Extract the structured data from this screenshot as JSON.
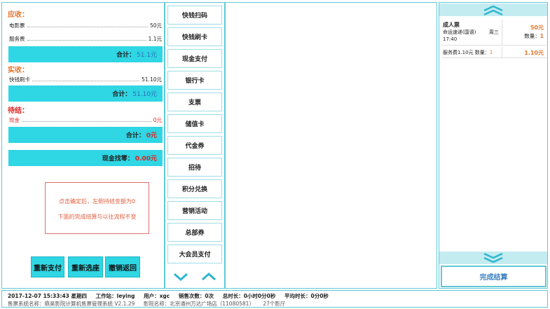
{
  "left": {
    "receivable": {
      "title": "应收：",
      "items": [
        {
          "label": "电影票",
          "value": "50元"
        },
        {
          "label": "服务费",
          "value": "1.1元"
        }
      ],
      "total_label": "合计：",
      "total_value": "51.1元"
    },
    "received": {
      "title": "实收：",
      "items": [
        {
          "label": "快钱刷卡",
          "value": "51.10元"
        }
      ],
      "total_label": "合计：",
      "total_value": "51.10元"
    },
    "pending": {
      "title": "待结：",
      "items": [
        {
          "label": "现金",
          "value": "0元"
        }
      ],
      "total_label": "合计：",
      "total_value": "0元"
    },
    "change": {
      "label": "现金找零：",
      "value": "0.00元"
    },
    "notice": [
      "点击确定后，左侧待结金额为0",
      "下面的完成结算与以往流程不变"
    ],
    "buttons": {
      "repay": "重新支付",
      "reselect": "重新选座",
      "cancel": "撤销返回"
    }
  },
  "payment_methods": [
    "快钱扫码",
    "快钱刷卡",
    "现金支付",
    "银行卡",
    "支票",
    "储值卡",
    "代金券",
    "招待",
    "积分兑换",
    "营销活动",
    "总部券",
    "大会员支付"
  ],
  "order": {
    "ticket_type": "成人票",
    "movie": "命运速递(国语)",
    "time": "17:40",
    "weekday": "周三",
    "price": "50元",
    "qty_label": "数量：",
    "qty": "1",
    "service_label": "服务费1.10元 数量：",
    "service_qty": "1",
    "service_total": "1.10元"
  },
  "finish_label": "完成结算",
  "status": {
    "line1": [
      "2017-12-07 15:33:43 星期四",
      "工作站：leying",
      "用户：xgc",
      "销售次数：0次",
      "总时长：0小时0分0秒",
      "平均时长：0分0秒"
    ],
    "line2": [
      "售票系统名称：鼎昊影院计算机售票管理系统 V2.1.29",
      "影院名称：北京通州万达广场店（11080581）",
      "27个影厅"
    ]
  },
  "colors": {
    "accent": "#2fd6e4",
    "border": "#5fc9d5",
    "orange": "#e8752b",
    "red": "#e02020"
  }
}
